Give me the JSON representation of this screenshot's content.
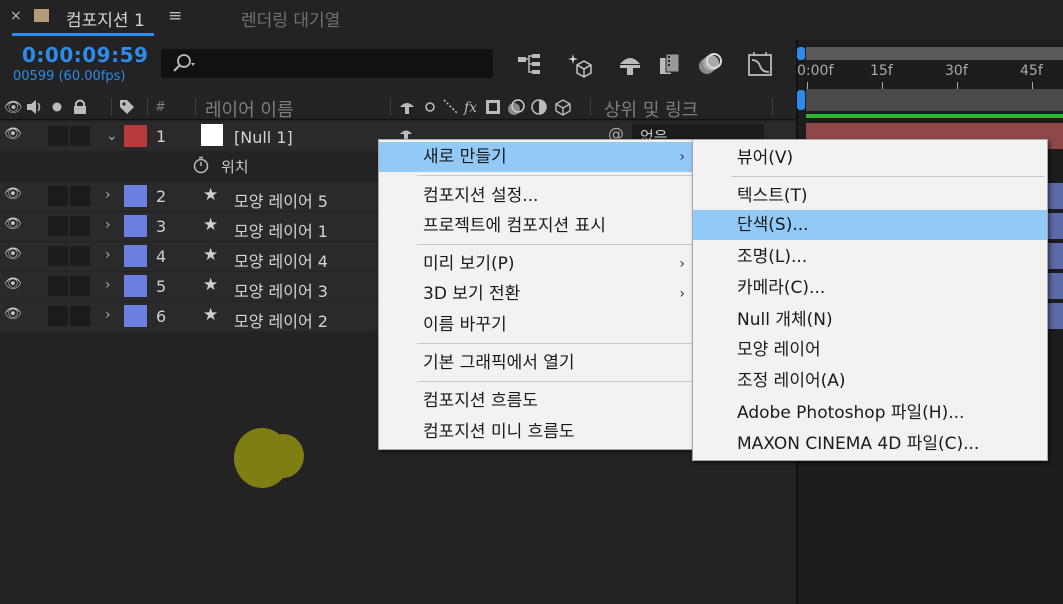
{
  "tabbar": {
    "close_glyph": "×",
    "comp_tab_title": "컴포지션 1",
    "menu_glyph": "≡",
    "render_queue_tab": "렌더링 대기열"
  },
  "timecode": {
    "time": "0:00:09:59",
    "frames": "00599 (60.00fps)"
  },
  "ruler": {
    "labels": [
      "0:00f",
      "15f",
      "30f",
      "45f"
    ]
  },
  "header": {
    "hash": "#",
    "layer_name": "레이어 이름",
    "parent_link": "상위 및 링크"
  },
  "layers": [
    {
      "num": "1",
      "name": "[Null 1]",
      "color": "#b83a3a",
      "type": "null"
    },
    {
      "num": "2",
      "name": "모양 레이어 5",
      "color": "#6b7fe0",
      "type": "shape"
    },
    {
      "num": "3",
      "name": "모양 레이어 1",
      "color": "#6b7fe0",
      "type": "shape"
    },
    {
      "num": "4",
      "name": "모양 레이어 4",
      "color": "#6b7fe0",
      "type": "shape"
    },
    {
      "num": "5",
      "name": "모양 레이어 3",
      "color": "#6b7fe0",
      "type": "shape"
    },
    {
      "num": "6",
      "name": "모양 레이어 2",
      "color": "#6b7fe0",
      "type": "shape"
    }
  ],
  "position_prop": "위치",
  "parent_value": "없음",
  "context_menu": {
    "items": [
      "새로 만들기",
      "컴포지션 설정...",
      "프로젝트에 컴포지션 표시",
      "미리 보기(P)",
      "3D 보기 전환",
      "이름 바꾸기",
      "기본 그래픽에서 열기",
      "컴포지션 흐름도",
      "컴포지션 미니 흐름도"
    ],
    "submenu_arrow": "›"
  },
  "submenu": {
    "items": [
      "뷰어(V)",
      "텍스트(T)",
      "단색(S)...",
      "조명(L)...",
      "카메라(C)...",
      "Null 개체(N)",
      "모양 레이어",
      "조정 레이어(A)",
      "Adobe Photoshop 파일(H)...",
      "MAXON CINEMA 4D 파일(C)..."
    ]
  },
  "colors": {
    "accent": "#2d8ceb",
    "menu_highlight": "#91c9f7",
    "null_label": "#b83a3a",
    "shape_label": "#6b7fe0",
    "layer_bar_null": "#8e4848",
    "layer_bar_shape": "#5b6aa8",
    "blob": "#7f7e13"
  }
}
